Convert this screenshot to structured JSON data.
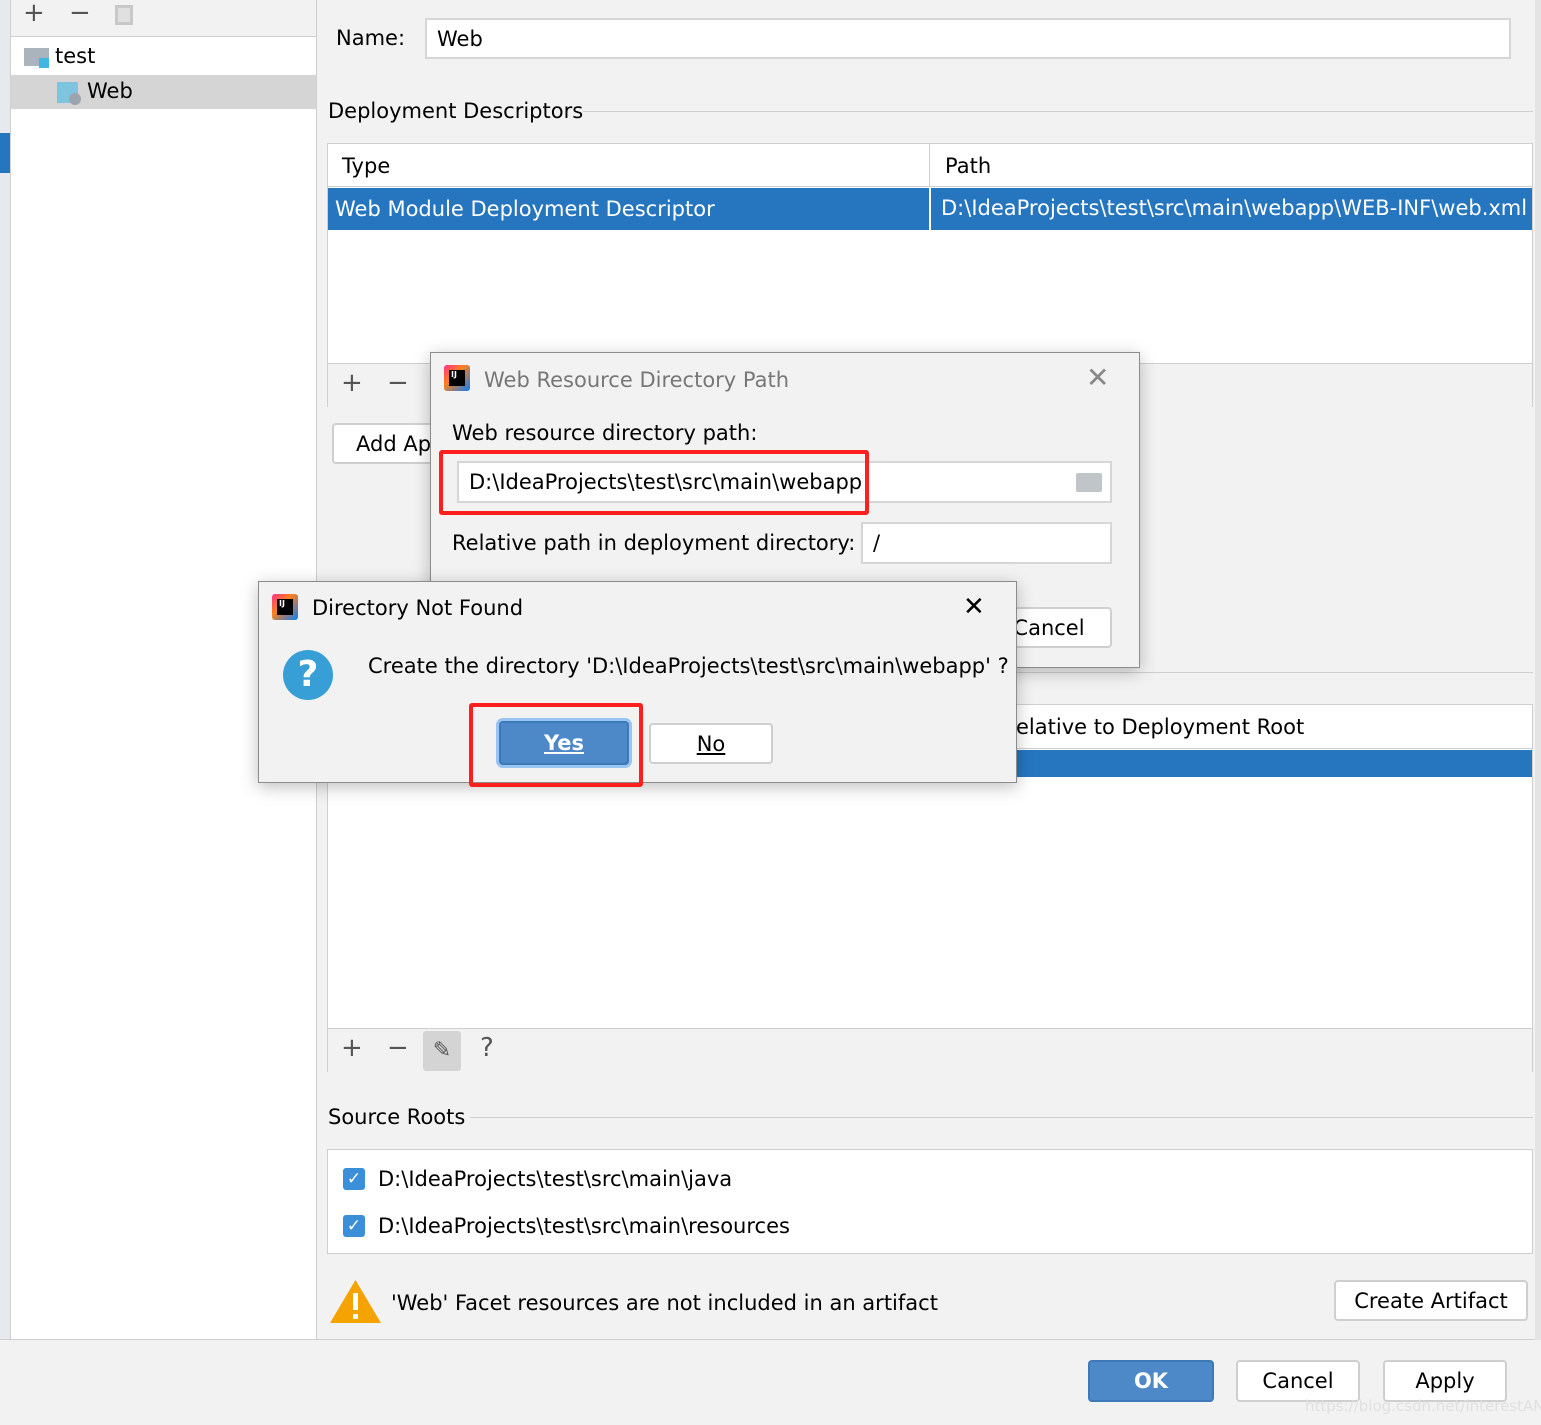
{
  "sidebar": {
    "toolbar": {
      "add": "+",
      "remove": "−"
    },
    "tree": [
      {
        "label": "test"
      },
      {
        "label": "Web"
      }
    ]
  },
  "form": {
    "name_label": "Name:",
    "name_value": "Web",
    "deployment_descriptors": {
      "title": "Deployment Descriptors",
      "columns": [
        "Type",
        "Path"
      ],
      "rows": [
        {
          "type": "Web Module Deployment Descriptor",
          "path": "D:\\IdeaProjects\\test\\src\\main\\webapp\\WEB-INF\\web.xml"
        }
      ],
      "add": "+",
      "remove": "−",
      "add_app_server_button": "Add Ap"
    },
    "web_resources": {
      "visible_column": "elative to Deployment Root",
      "add": "+",
      "remove": "−",
      "help": "?"
    },
    "source_roots": {
      "title": "Source Roots",
      "items": [
        {
          "path": "D:\\IdeaProjects\\test\\src\\main\\java",
          "checked": true
        },
        {
          "path": "D:\\IdeaProjects\\test\\src\\main\\resources",
          "checked": true
        }
      ]
    },
    "warning": "'Web' Facet resources are not included in an artifact",
    "create_artifact": "Create Artifact"
  },
  "footer": {
    "ok": "OK",
    "cancel": "Cancel",
    "apply": "Apply"
  },
  "web_resource_dialog": {
    "title": "Web Resource Directory Path",
    "path_label": "Web resource directory path:",
    "path_value": "D:\\IdeaProjects\\test\\src\\main\\webapp",
    "relative_label": "Relative path in deployment directory:",
    "relative_value": "/",
    "cancel": "Cancel"
  },
  "confirm_dialog": {
    "title": "Directory Not Found",
    "message": "Create the directory 'D:\\IdeaProjects\\test\\src\\main\\webapp' ?",
    "yes": "Yes",
    "no": "No"
  },
  "watermark": "https://blog.csdn.net/interestANd",
  "colors": {
    "selection": "#2675bf",
    "primary_button": "#4d89c9",
    "highlight": "#ff1f1f",
    "warning": "#f5a300"
  }
}
